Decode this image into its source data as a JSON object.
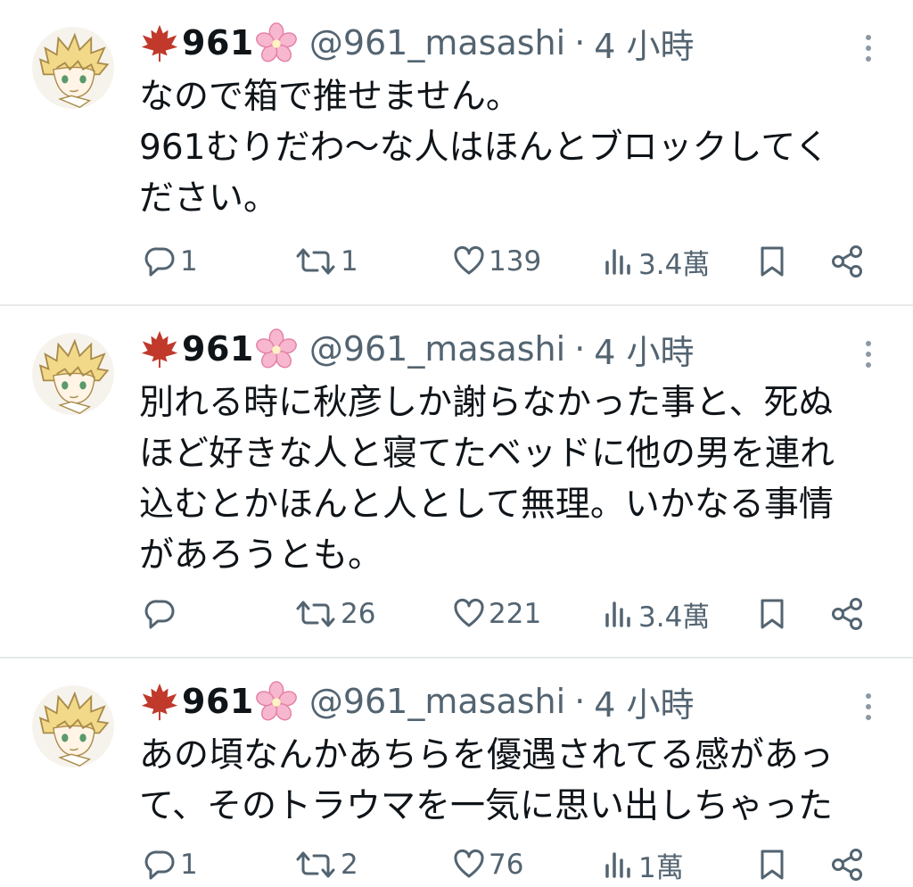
{
  "colors": {
    "text": "#0f1419",
    "secondary": "#536471",
    "divider": "#e7e9ea",
    "leaf": "#c0392b",
    "blossom": "#f5a3c0"
  },
  "tweets": [
    {
      "display_name": "961",
      "handle": "@961_masashi",
      "separator": "·",
      "time": "4 小時",
      "lines": [
        "なので箱で推せません。",
        "961むりだわ〜な人はほんとブロックしてく",
        "ださい。"
      ],
      "replies": "1",
      "retweets": "1",
      "likes": "139",
      "views": "3.4萬"
    },
    {
      "display_name": "961",
      "handle": "@961_masashi",
      "separator": "·",
      "time": "4 小時",
      "lines": [
        "別れる時に秋彦しか謝らなかった事と、死ぬ",
        "ほど好きな人と寝てたベッドに他の男を連れ",
        "込むとかほんと人として無理。いかなる事情",
        "があろうとも。"
      ],
      "replies": "",
      "retweets": "26",
      "likes": "221",
      "views": "3.4萬"
    },
    {
      "display_name": "961",
      "handle": "@961_masashi",
      "separator": "·",
      "time": "4 小時",
      "lines": [
        "あの頃なんかあちらを優遇されてる感があっ",
        "て、そのトラウマを一気に思い出しちゃった"
      ],
      "replies": "1",
      "retweets": "2",
      "likes": "76",
      "views": "1萬"
    }
  ],
  "icons": [
    "maple-leaf-icon",
    "cherry-blossom-icon",
    "more-icon",
    "reply-icon",
    "retweet-icon",
    "like-icon",
    "views-icon",
    "bookmark-icon",
    "share-icon"
  ]
}
